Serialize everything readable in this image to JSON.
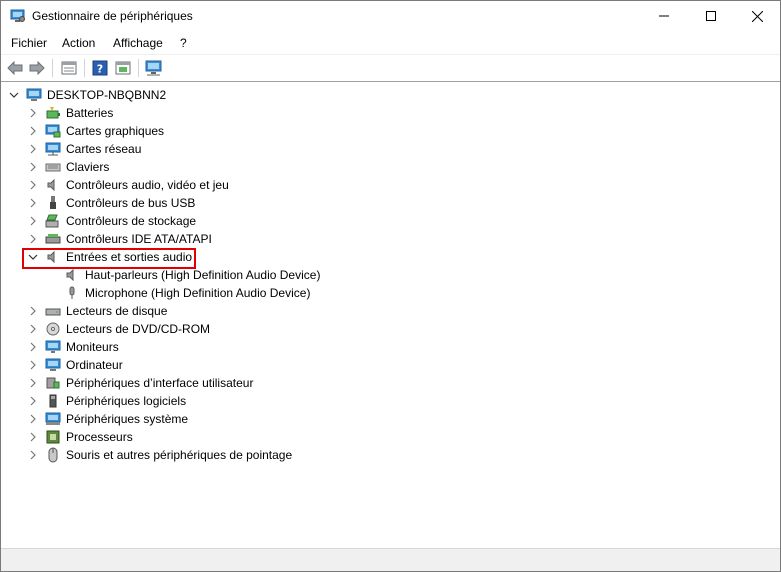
{
  "window": {
    "title": "Gestionnaire de périphériques"
  },
  "menu": {
    "items": [
      "Fichier",
      "Action",
      "Affichage",
      "?"
    ]
  },
  "toolbar": {
    "buttons": [
      "back-arrow-icon",
      "forward-arrow-icon",
      "properties-icon",
      "help-icon",
      "update-driver-icon",
      "scan-hardware-icon"
    ]
  },
  "tree": {
    "root": "DESKTOP-NBQBNN2",
    "categories": [
      {
        "label": "Batteries",
        "icon": "battery-icon"
      },
      {
        "label": "Cartes graphiques",
        "icon": "display-adapter-icon"
      },
      {
        "label": "Cartes réseau",
        "icon": "network-adapter-icon"
      },
      {
        "label": "Claviers",
        "icon": "keyboard-icon"
      },
      {
        "label": "Contrôleurs audio, vidéo et jeu",
        "icon": "speaker-icon"
      },
      {
        "label": "Contrôleurs de bus USB",
        "icon": "usb-icon"
      },
      {
        "label": "Contrôleurs de stockage",
        "icon": "storage-controller-icon"
      },
      {
        "label": "Contrôleurs IDE ATA/ATAPI",
        "icon": "ide-controller-icon"
      },
      {
        "label": "Entrées et sorties audio",
        "icon": "speaker-icon",
        "expanded": true,
        "children": [
          {
            "label": "Haut-parleurs (High Definition Audio Device)",
            "icon": "speaker-icon"
          },
          {
            "label": "Microphone (High Definition Audio Device)",
            "icon": "microphone-icon"
          }
        ]
      },
      {
        "label": "Lecteurs de disque",
        "icon": "disk-drive-icon"
      },
      {
        "label": "Lecteurs de DVD/CD-ROM",
        "icon": "dvd-icon"
      },
      {
        "label": "Moniteurs",
        "icon": "monitor-icon"
      },
      {
        "label": "Ordinateur",
        "icon": "computer-icon"
      },
      {
        "label": "Périphériques d’interface utilisateur",
        "icon": "hid-icon"
      },
      {
        "label": "Périphériques logiciels",
        "icon": "software-device-icon"
      },
      {
        "label": "Périphériques système",
        "icon": "system-device-icon"
      },
      {
        "label": "Processeurs",
        "icon": "processor-icon"
      },
      {
        "label": "Souris et autres périphériques de pointage",
        "icon": "mouse-icon"
      }
    ]
  },
  "colors": {
    "highlight": "#e00000",
    "monitor_blue": "#2f8fd8"
  }
}
